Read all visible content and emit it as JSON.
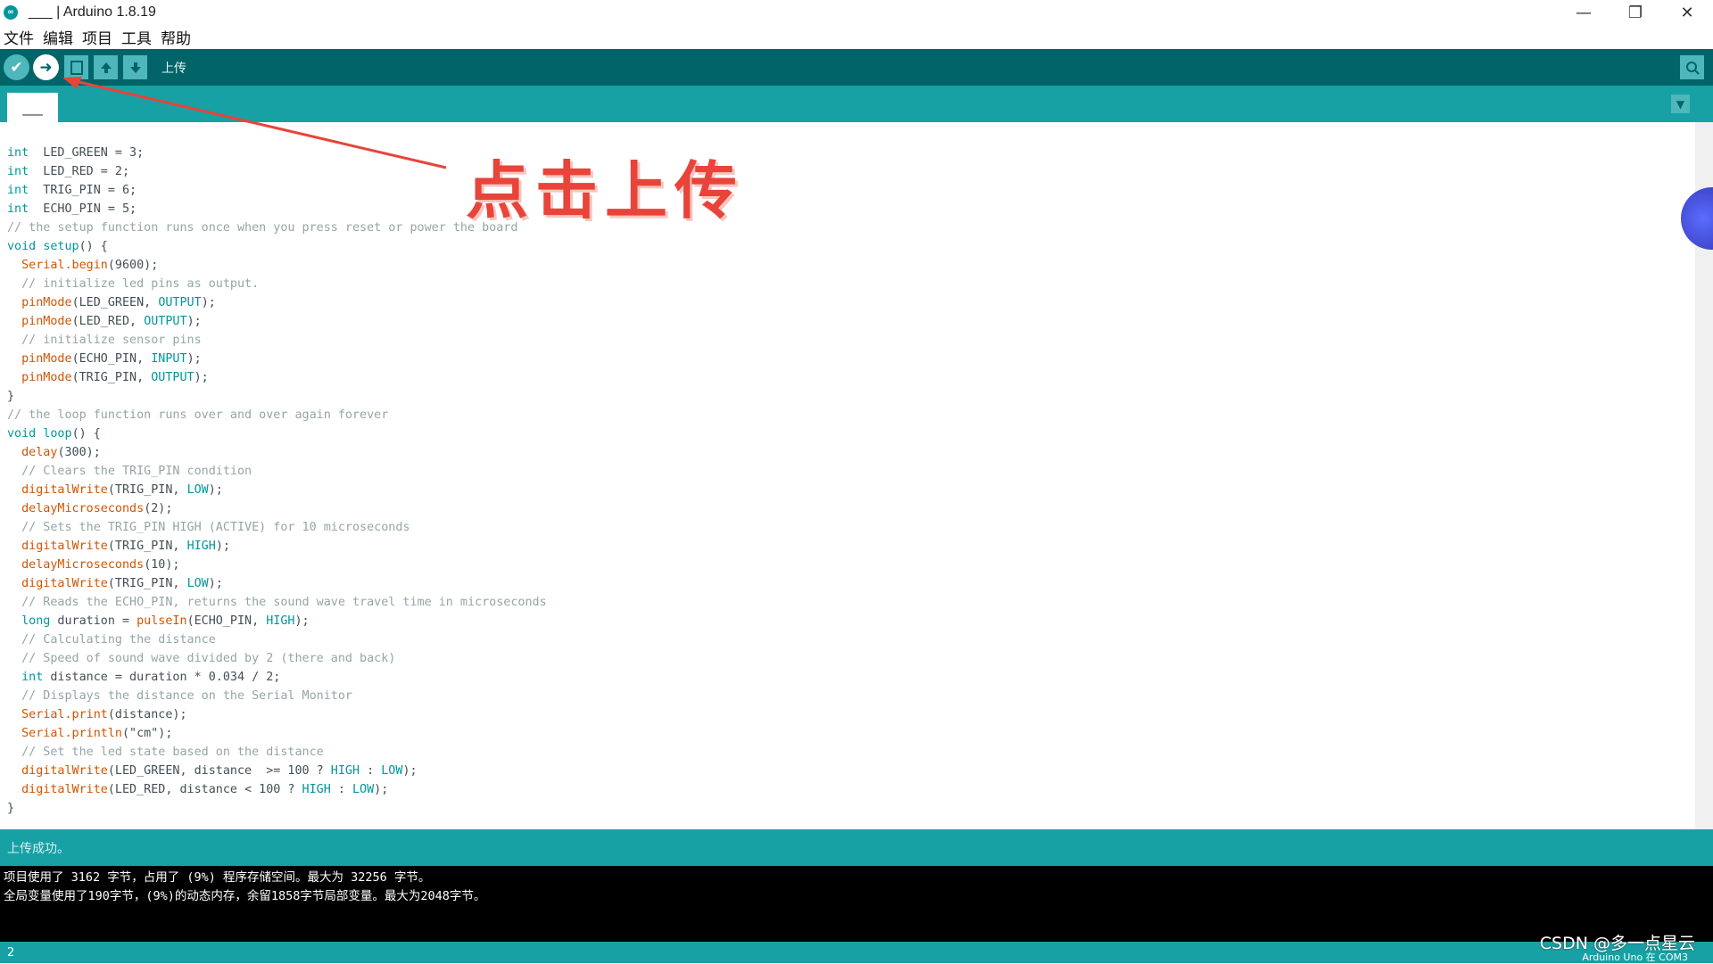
{
  "window": {
    "title": "___ | Arduino 1.8.19",
    "app_icon_glyph": "∞",
    "controls": [
      "—",
      "❐",
      "✕"
    ]
  },
  "menu": {
    "items": [
      "文件",
      "编辑",
      "项目",
      "工具",
      "帮助"
    ]
  },
  "toolbar": {
    "verify_icon": "✔",
    "upload_icon": "➜",
    "new_icon": "📄",
    "open_icon": "⬆",
    "save_icon": "⬇",
    "hover_label": "上传",
    "serial_monitor_icon": "⌕"
  },
  "tabs": {
    "active_tab": "___",
    "menu_icon": "▼"
  },
  "annotation": {
    "text": "点击上传",
    "color": "#e8443a"
  },
  "code_lines": [
    [
      [
        "kw",
        "int"
      ],
      [
        "",
        "  LED_GREEN = 3;"
      ]
    ],
    [
      [
        "kw",
        "int"
      ],
      [
        "",
        "  LED_RED = 2;"
      ]
    ],
    [
      [
        "kw",
        "int"
      ],
      [
        "",
        "  TRIG_PIN = 6;"
      ]
    ],
    [
      [
        "kw",
        "int"
      ],
      [
        "",
        "  ECHO_PIN = 5;"
      ]
    ],
    [
      [
        "cm",
        "// the setup function runs once when you press reset or power the board"
      ]
    ],
    [
      [
        "kw",
        "void"
      ],
      [
        "",
        " "
      ],
      [
        "kw",
        "setup"
      ],
      [
        "",
        "() {"
      ]
    ],
    [
      [
        "",
        "  "
      ],
      [
        "fn",
        "Serial"
      ],
      [
        "",
        ""
      ],
      [
        "fn",
        ".begin"
      ],
      [
        "",
        "(9600);"
      ]
    ],
    [
      [
        "cm",
        "  // initialize led pins as output."
      ]
    ],
    [
      [
        "",
        "  "
      ],
      [
        "fn",
        "pinMode"
      ],
      [
        "",
        "(LED_GREEN, "
      ],
      [
        "cst",
        "OUTPUT"
      ],
      [
        "",
        ");"
      ]
    ],
    [
      [
        "",
        "  "
      ],
      [
        "fn",
        "pinMode"
      ],
      [
        "",
        "(LED_RED, "
      ],
      [
        "cst",
        "OUTPUT"
      ],
      [
        "",
        ");"
      ]
    ],
    [
      [
        "cm",
        "  // initialize sensor pins"
      ]
    ],
    [
      [
        "",
        "  "
      ],
      [
        "fn",
        "pinMode"
      ],
      [
        "",
        "(ECHO_PIN, "
      ],
      [
        "cst",
        "INPUT"
      ],
      [
        "",
        ");"
      ]
    ],
    [
      [
        "",
        "  "
      ],
      [
        "fn",
        "pinMode"
      ],
      [
        "",
        "(TRIG_PIN, "
      ],
      [
        "cst",
        "OUTPUT"
      ],
      [
        "",
        ");"
      ]
    ],
    [
      [
        "",
        "}"
      ]
    ],
    [
      [
        "cm",
        "// the loop function runs over and over again forever"
      ]
    ],
    [
      [
        "kw",
        "void"
      ],
      [
        "",
        " "
      ],
      [
        "kw",
        "loop"
      ],
      [
        "",
        "() {"
      ]
    ],
    [
      [
        "",
        "  "
      ],
      [
        "fn",
        "delay"
      ],
      [
        "",
        "(300);"
      ]
    ],
    [
      [
        "cm",
        "  // Clears the TRIG_PIN condition"
      ]
    ],
    [
      [
        "",
        "  "
      ],
      [
        "fn",
        "digitalWrite"
      ],
      [
        "",
        "(TRIG_PIN, "
      ],
      [
        "cst",
        "LOW"
      ],
      [
        "",
        ");"
      ]
    ],
    [
      [
        "",
        "  "
      ],
      [
        "fn",
        "delayMicroseconds"
      ],
      [
        "",
        "(2);"
      ]
    ],
    [
      [
        "cm",
        "  // Sets the TRIG_PIN HIGH (ACTIVE) for 10 microseconds"
      ]
    ],
    [
      [
        "",
        "  "
      ],
      [
        "fn",
        "digitalWrite"
      ],
      [
        "",
        "(TRIG_PIN, "
      ],
      [
        "cst",
        "HIGH"
      ],
      [
        "",
        ");"
      ]
    ],
    [
      [
        "",
        "  "
      ],
      [
        "fn",
        "delayMicroseconds"
      ],
      [
        "",
        "(10);"
      ]
    ],
    [
      [
        "",
        "  "
      ],
      [
        "fn",
        "digitalWrite"
      ],
      [
        "",
        "(TRIG_PIN, "
      ],
      [
        "cst",
        "LOW"
      ],
      [
        "",
        ");"
      ]
    ],
    [
      [
        "cm",
        "  // Reads the ECHO_PIN, returns the sound wave travel time in microseconds"
      ]
    ],
    [
      [
        "",
        "  "
      ],
      [
        "kw",
        "long"
      ],
      [
        "",
        " duration = "
      ],
      [
        "fn",
        "pulseIn"
      ],
      [
        "",
        "(ECHO_PIN, "
      ],
      [
        "cst",
        "HIGH"
      ],
      [
        "",
        ");"
      ]
    ],
    [
      [
        "cm",
        "  // Calculating the distance"
      ]
    ],
    [
      [
        "cm",
        "  // Speed of sound wave divided by 2 (there and back)"
      ]
    ],
    [
      [
        "",
        "  "
      ],
      [
        "kw",
        "int"
      ],
      [
        "",
        " distance = duration * 0.034 / 2;"
      ]
    ],
    [
      [
        "cm",
        "  // Displays the distance on the Serial Monitor"
      ]
    ],
    [
      [
        "",
        "  "
      ],
      [
        "fn",
        "Serial"
      ],
      [
        "fn",
        ".print"
      ],
      [
        "",
        "(distance);"
      ]
    ],
    [
      [
        "",
        "  "
      ],
      [
        "fn",
        "Serial"
      ],
      [
        "fn",
        ".println"
      ],
      [
        "",
        "(\"cm\");"
      ]
    ],
    [
      [
        "cm",
        "  // Set the led state based on the distance"
      ]
    ],
    [
      [
        "",
        "  "
      ],
      [
        "fn",
        "digitalWrite"
      ],
      [
        "",
        "(LED_GREEN, distance  >= 100 ? "
      ],
      [
        "cst",
        "HIGH"
      ],
      [
        "",
        " : "
      ],
      [
        "cst",
        "LOW"
      ],
      [
        "",
        ");"
      ]
    ],
    [
      [
        "",
        "  "
      ],
      [
        "fn",
        "digitalWrite"
      ],
      [
        "",
        "(LED_RED, distance < 100 ? "
      ],
      [
        "cst",
        "HIGH"
      ],
      [
        "",
        " : "
      ],
      [
        "cst",
        "LOW"
      ],
      [
        "",
        ");"
      ]
    ],
    [
      [
        "",
        "}"
      ]
    ]
  ],
  "status": {
    "message": "上传成功。"
  },
  "console": {
    "lines": [
      "项目使用了 3162 字节，占用了 (9%) 程序存储空间。最大为 32256 字节。",
      "全局变量使用了190字节，(9%)的动态内存，余留1858字节局部变量。最大为2048字节。"
    ]
  },
  "footer": {
    "line_number": "2",
    "board": "Arduino Uno 在 COM3"
  },
  "watermark": "CSDN @多一点星云",
  "colors": {
    "toolbar": "#006468",
    "tabbar": "#17a1a5",
    "keyword": "#00979c",
    "function": "#d35400",
    "comment": "#95a5a6"
  }
}
